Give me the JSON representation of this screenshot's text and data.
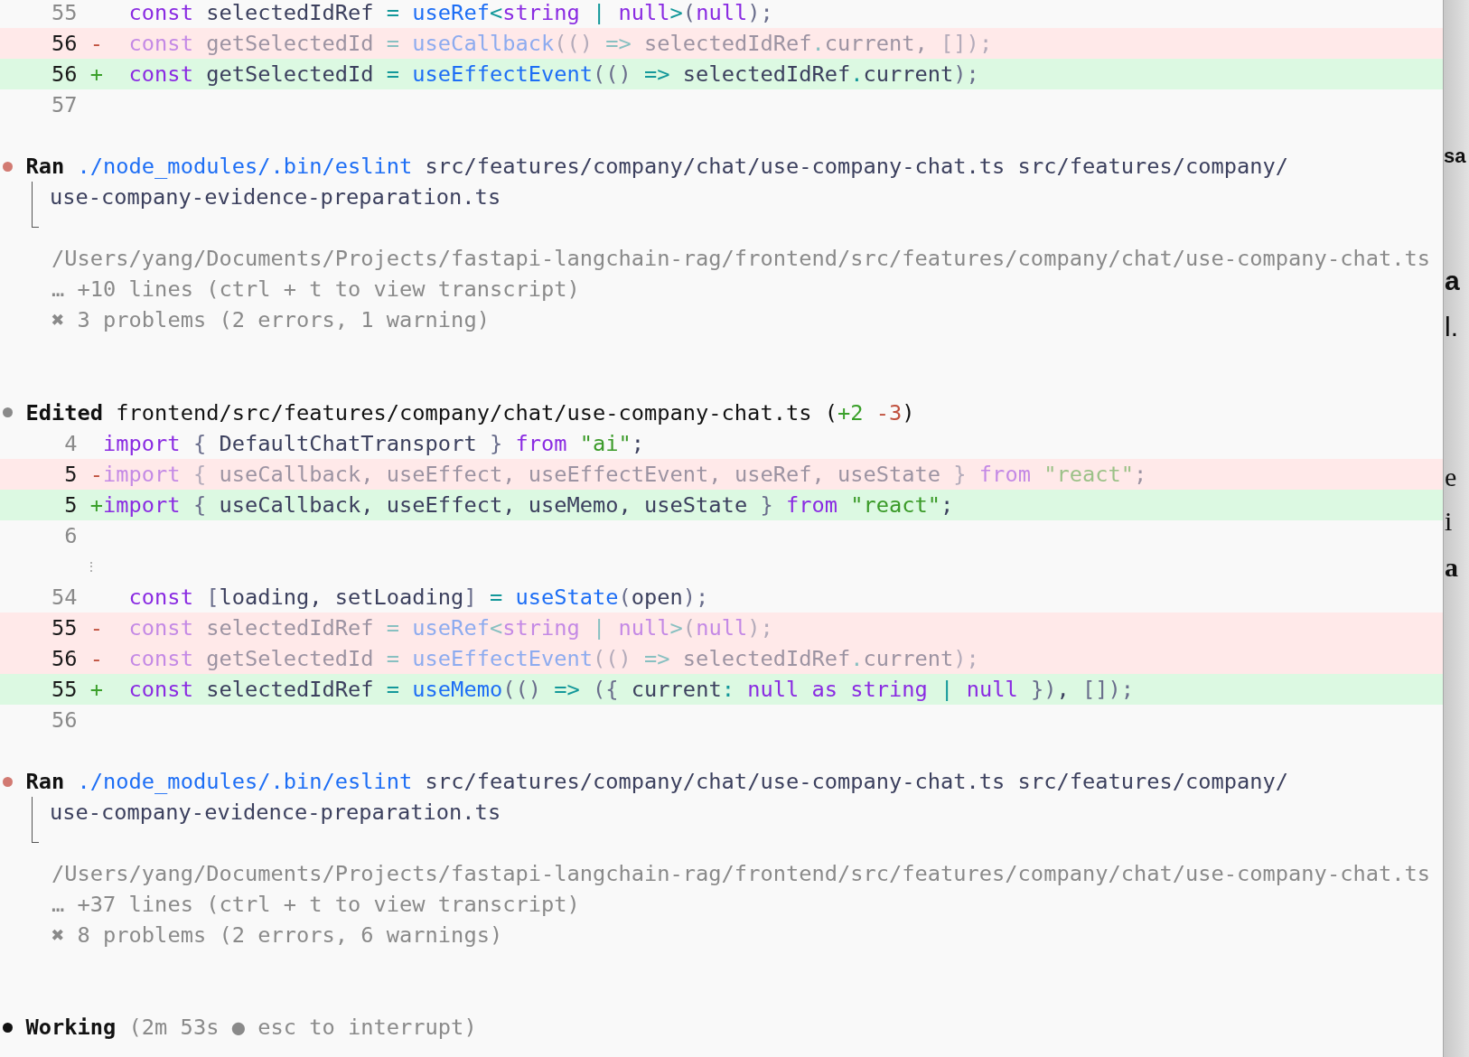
{
  "transcript": [
    {
      "kind": "diff",
      "lines": [
        {
          "kind": "context",
          "number": "55",
          "tokens": [
            {
              "kind": "keyword",
              "text": "  const"
            },
            {
              "kind": "text",
              "text": " selectedIdRef "
            },
            {
              "kind": "operator",
              "text": "="
            },
            {
              "kind": "function",
              "text": " useRef"
            },
            {
              "kind": "operator",
              "text": "<"
            },
            {
              "kind": "keyword",
              "text": "string"
            },
            {
              "kind": "operator",
              "text": " |"
            },
            {
              "kind": "keyword",
              "text": " null"
            },
            {
              "kind": "operator",
              "text": ">"
            },
            {
              "kind": "punct",
              "text": "("
            },
            {
              "kind": "keyword",
              "text": "null"
            },
            {
              "kind": "punct",
              "text": ");"
            }
          ]
        },
        {
          "kind": "removed",
          "number": "56",
          "sign": "-",
          "tokens": [
            {
              "kind": "keyword",
              "text": "  const"
            },
            {
              "kind": "text",
              "text": " getSelectedId "
            },
            {
              "kind": "operator",
              "text": "="
            },
            {
              "kind": "function",
              "text": " useCallback"
            },
            {
              "kind": "punct",
              "text": "(()"
            },
            {
              "kind": "operator",
              "text": " =>"
            },
            {
              "kind": "text",
              "text": " selectedIdRef"
            },
            {
              "kind": "operator",
              "text": "."
            },
            {
              "kind": "text",
              "text": "current, "
            },
            {
              "kind": "punct",
              "text": "[]);"
            }
          ]
        },
        {
          "kind": "added",
          "number": "56",
          "sign": "+",
          "tokens": [
            {
              "kind": "keyword",
              "text": "  const"
            },
            {
              "kind": "text",
              "text": " getSelectedId "
            },
            {
              "kind": "operator",
              "text": "="
            },
            {
              "kind": "function",
              "text": " useEffectEvent"
            },
            {
              "kind": "punct",
              "text": "(()"
            },
            {
              "kind": "operator",
              "text": " =>"
            },
            {
              "kind": "text",
              "text": " selectedIdRef"
            },
            {
              "kind": "operator",
              "text": "."
            },
            {
              "kind": "text",
              "text": "current"
            },
            {
              "kind": "punct",
              "text": ");"
            }
          ]
        },
        {
          "kind": "context",
          "number": "57"
        }
      ]
    },
    {
      "kind": "action",
      "color": "#d27a72",
      "label": "Ran",
      "tokens": [
        {
          "kind": "function",
          "text": "./node_modules/.bin/eslint"
        },
        {
          "kind": "text",
          "text": " src/features/company/chat/use-company-chat.ts src/features/company/"
        }
      ],
      "continuation": "use-company-evidence-preparation.ts",
      "output": [
        "/Users/yang/Documents/Projects/fastapi-langchain-rag/frontend/src/features/company/chat/use-company-chat.ts",
        "… +10 lines (ctrl + t to view transcript)",
        "✖ 3 problems (2 errors, 1 warning)"
      ]
    },
    {
      "kind": "action",
      "color": "#8a8a8a",
      "label": "Edited",
      "tokens": [
        {
          "kind": "heading",
          "text": "frontend/src/features/company/chat/use-company-chat.ts ("
        },
        {
          "kind": "added",
          "text": "+2"
        },
        {
          "kind": "removed",
          "text": " -3"
        },
        {
          "kind": "heading",
          "text": ")"
        }
      ],
      "diff": [
        {
          "kind": "context",
          "number": "4",
          "tokens": [
            {
              "kind": "keyword",
              "text": "import"
            },
            {
              "kind": "punct",
              "text": " {"
            },
            {
              "kind": "text",
              "text": " DefaultChatTransport "
            },
            {
              "kind": "punct",
              "text": "}"
            },
            {
              "kind": "keyword",
              "text": " from"
            },
            {
              "kind": "string",
              "text": " \"ai\""
            },
            {
              "kind": "text",
              "text": ";"
            }
          ]
        },
        {
          "kind": "removed",
          "number": "5",
          "sign": "-",
          "tokens": [
            {
              "kind": "keyword",
              "text": "import"
            },
            {
              "kind": "punct",
              "text": " {"
            },
            {
              "kind": "text",
              "text": " useCallback, useEffect, useEffectEvent, useRef, useState "
            },
            {
              "kind": "punct",
              "text": "}"
            },
            {
              "kind": "keyword",
              "text": " from"
            },
            {
              "kind": "string",
              "text": " \"react\""
            },
            {
              "kind": "text",
              "text": ";"
            }
          ]
        },
        {
          "kind": "added",
          "number": "5",
          "sign": "+",
          "tokens": [
            {
              "kind": "keyword",
              "text": "import"
            },
            {
              "kind": "punct",
              "text": " {"
            },
            {
              "kind": "text",
              "text": " useCallback, useEffect, useMemo, useState "
            },
            {
              "kind": "punct",
              "text": "}"
            },
            {
              "kind": "keyword",
              "text": " from"
            },
            {
              "kind": "string",
              "text": " \"react\""
            },
            {
              "kind": "text",
              "text": ";"
            }
          ]
        },
        {
          "kind": "context",
          "number": "6"
        },
        {
          "kind": "gap",
          "sign": "⋮"
        },
        {
          "kind": "context",
          "number": "54",
          "tokens": [
            {
              "kind": "keyword",
              "text": "  const"
            },
            {
              "kind": "punct",
              "text": " ["
            },
            {
              "kind": "text",
              "text": "loading, setLoading"
            },
            {
              "kind": "punct",
              "text": "]"
            },
            {
              "kind": "operator",
              "text": " ="
            },
            {
              "kind": "function",
              "text": " useState"
            },
            {
              "kind": "punct",
              "text": "("
            },
            {
              "kind": "text",
              "text": "open"
            },
            {
              "kind": "punct",
              "text": ");"
            }
          ]
        },
        {
          "kind": "removed",
          "number": "55",
          "sign": "-",
          "tokens": [
            {
              "kind": "keyword",
              "text": "  const"
            },
            {
              "kind": "text",
              "text": " selectedIdRef "
            },
            {
              "kind": "operator",
              "text": "="
            },
            {
              "kind": "function",
              "text": " useRef"
            },
            {
              "kind": "operator",
              "text": "<"
            },
            {
              "kind": "keyword",
              "text": "string"
            },
            {
              "kind": "operator",
              "text": " |"
            },
            {
              "kind": "keyword",
              "text": " null"
            },
            {
              "kind": "operator",
              "text": ">"
            },
            {
              "kind": "punct",
              "text": "("
            },
            {
              "kind": "keyword",
              "text": "null"
            },
            {
              "kind": "punct",
              "text": ");"
            }
          ]
        },
        {
          "kind": "removed",
          "number": "56",
          "sign": "-",
          "tokens": [
            {
              "kind": "keyword",
              "text": "  const"
            },
            {
              "kind": "text",
              "text": " getSelectedId "
            },
            {
              "kind": "operator",
              "text": "="
            },
            {
              "kind": "function",
              "text": " useEffectEvent"
            },
            {
              "kind": "punct",
              "text": "(()"
            },
            {
              "kind": "operator",
              "text": " =>"
            },
            {
              "kind": "text",
              "text": " selectedIdRef"
            },
            {
              "kind": "operator",
              "text": "."
            },
            {
              "kind": "text",
              "text": "current"
            },
            {
              "kind": "punct",
              "text": ");"
            }
          ]
        },
        {
          "kind": "added",
          "number": "55",
          "sign": "+",
          "tokens": [
            {
              "kind": "keyword",
              "text": "  const"
            },
            {
              "kind": "text",
              "text": " selectedIdRef "
            },
            {
              "kind": "operator",
              "text": "="
            },
            {
              "kind": "function",
              "text": " useMemo"
            },
            {
              "kind": "punct",
              "text": "(()"
            },
            {
              "kind": "operator",
              "text": " =>"
            },
            {
              "kind": "punct",
              "text": " ({"
            },
            {
              "kind": "text",
              "text": " current"
            },
            {
              "kind": "operator",
              "text": ":"
            },
            {
              "kind": "keyword",
              "text": " null"
            },
            {
              "kind": "keyword",
              "text": " as"
            },
            {
              "kind": "keyword",
              "text": " string"
            },
            {
              "kind": "operator",
              "text": " |"
            },
            {
              "kind": "keyword",
              "text": " null"
            },
            {
              "kind": "punct",
              "text": " })"
            },
            {
              "kind": "text",
              "text": ", "
            },
            {
              "kind": "punct",
              "text": "[]"
            },
            {
              "kind": "punct",
              "text": ");"
            }
          ]
        },
        {
          "kind": "context",
          "number": "56"
        }
      ]
    },
    {
      "kind": "action",
      "color": "#d27a72",
      "label": "Ran",
      "tokens": [
        {
          "kind": "function",
          "text": "./node_modules/.bin/eslint"
        },
        {
          "kind": "text",
          "text": " src/features/company/chat/use-company-chat.ts src/features/company/"
        }
      ],
      "continuation": "use-company-evidence-preparation.ts",
      "output": [
        "/Users/yang/Documents/Projects/fastapi-langchain-rag/frontend/src/features/company/chat/use-company-chat.ts",
        "… +37 lines (ctrl + t to view transcript)",
        "✖ 8 problems (2 errors, 6 warnings)"
      ]
    },
    {
      "kind": "action",
      "color": "#111111",
      "label": "Working",
      "tokens": [
        {
          "kind": "muted",
          "text": "(2m 53s "
        },
        {
          "kind": "bullet",
          "text": "●"
        },
        {
          "kind": "muted",
          "text": " esc to interrupt)"
        }
      ]
    }
  ],
  "edge_fragments": [
    "sa",
    "a",
    "l.",
    "e",
    "i",
    "a"
  ]
}
